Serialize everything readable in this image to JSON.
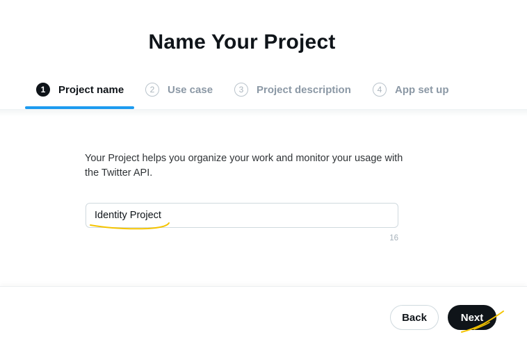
{
  "page": {
    "title": "Name Your Project"
  },
  "stepper": {
    "steps": [
      {
        "number": "1",
        "label": "Project name",
        "state": "active"
      },
      {
        "number": "2",
        "label": "Use case",
        "state": "inactive"
      },
      {
        "number": "3",
        "label": "Project description",
        "state": "inactive"
      },
      {
        "number": "4",
        "label": "App set up",
        "state": "inactive"
      }
    ]
  },
  "form": {
    "description": "Your Project helps you organize your work and monitor your usage with the Twitter API.",
    "project_name_value": "Identity Project",
    "char_count": "16"
  },
  "footer": {
    "back_label": "Back",
    "next_label": "Next"
  },
  "colors": {
    "accent": "#1d9bf0",
    "primary_button": "#0f1419",
    "annotation": "#f5c400"
  }
}
